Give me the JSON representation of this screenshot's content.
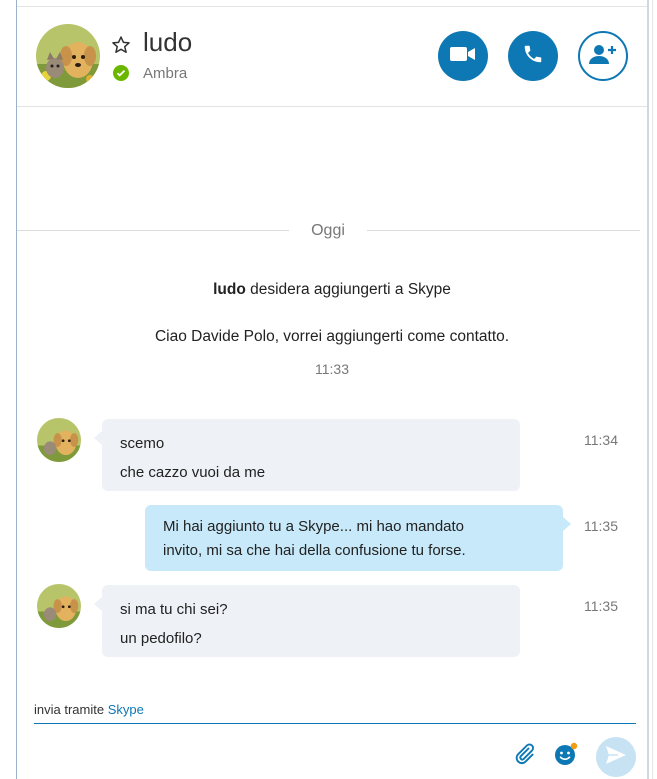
{
  "header": {
    "contact_name": "ludo",
    "status_text": "Ambra",
    "status_color": "#6bb700",
    "avatar": "puppy-and-kitten-avatar",
    "actions": [
      {
        "name": "video-call",
        "icon": "video-camera-icon"
      },
      {
        "name": "audio-call",
        "icon": "phone-icon"
      },
      {
        "name": "add-contact",
        "icon": "add-person-icon"
      }
    ],
    "accent_color": "#0e78b4"
  },
  "conversation": {
    "date_separator": "Oggi",
    "system": {
      "request_name": "ludo",
      "request_text": " desidera aggiungerti a Skype",
      "request_message": "Ciao Davide Polo, vorrei aggiungerti come contatto.",
      "time": "11:33"
    },
    "messages": [
      {
        "direction": "incoming",
        "lines": [
          "scemo",
          "che cazzo vuoi da me"
        ],
        "time": "11:34"
      },
      {
        "direction": "outgoing",
        "lines": [
          "Mi hai aggiunto tu a Skype... mi hao mandato",
          "invito, mi sa che hai della confusione tu forse."
        ],
        "time": "11:35"
      },
      {
        "direction": "incoming",
        "lines": [
          "si ma tu chi sei?",
          "un pedofilo?"
        ],
        "time": "11:35"
      }
    ],
    "bubble_colors": {
      "incoming": "#eef1f6",
      "outgoing": "#c7e9f9"
    }
  },
  "composer": {
    "via_prefix": "invia tramite ",
    "via_link": "Skype",
    "buttons": [
      {
        "name": "attach",
        "icon": "paperclip-icon"
      },
      {
        "name": "emoji",
        "icon": "emoji-icon"
      },
      {
        "name": "send",
        "icon": "send-icon"
      }
    ]
  }
}
